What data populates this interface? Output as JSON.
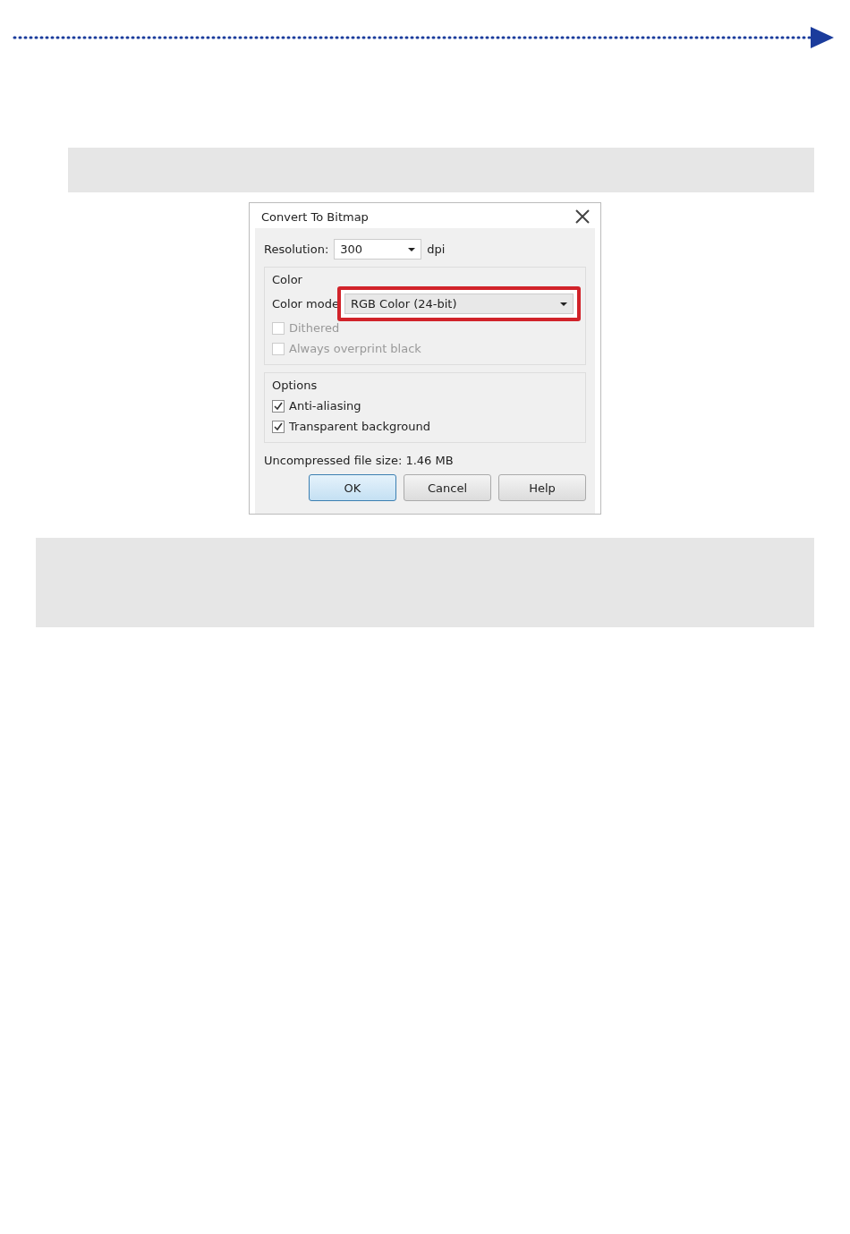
{
  "dialog": {
    "title": "Convert To Bitmap",
    "resolution": {
      "label": "Resolution:",
      "value": "300",
      "unit": "dpi"
    },
    "color_group": {
      "title": "Color",
      "mode_label": "Color mode",
      "mode_value": "RGB Color (24-bit)",
      "highlighted": true,
      "checkboxes": [
        {
          "label": "Dithered",
          "checked": false,
          "disabled": true
        },
        {
          "label": "Always overprint black",
          "checked": false,
          "disabled": true
        }
      ]
    },
    "options_group": {
      "title": "Options",
      "checkboxes": [
        {
          "label": "Anti-aliasing",
          "checked": true,
          "disabled": false
        },
        {
          "label": "Transparent background",
          "checked": true,
          "disabled": false
        }
      ]
    },
    "file_size": "Uncompressed file size: 1.46 MB",
    "buttons": [
      {
        "label": "OK",
        "default": true
      },
      {
        "label": "Cancel",
        "default": false
      },
      {
        "label": "Help",
        "default": false
      }
    ]
  }
}
